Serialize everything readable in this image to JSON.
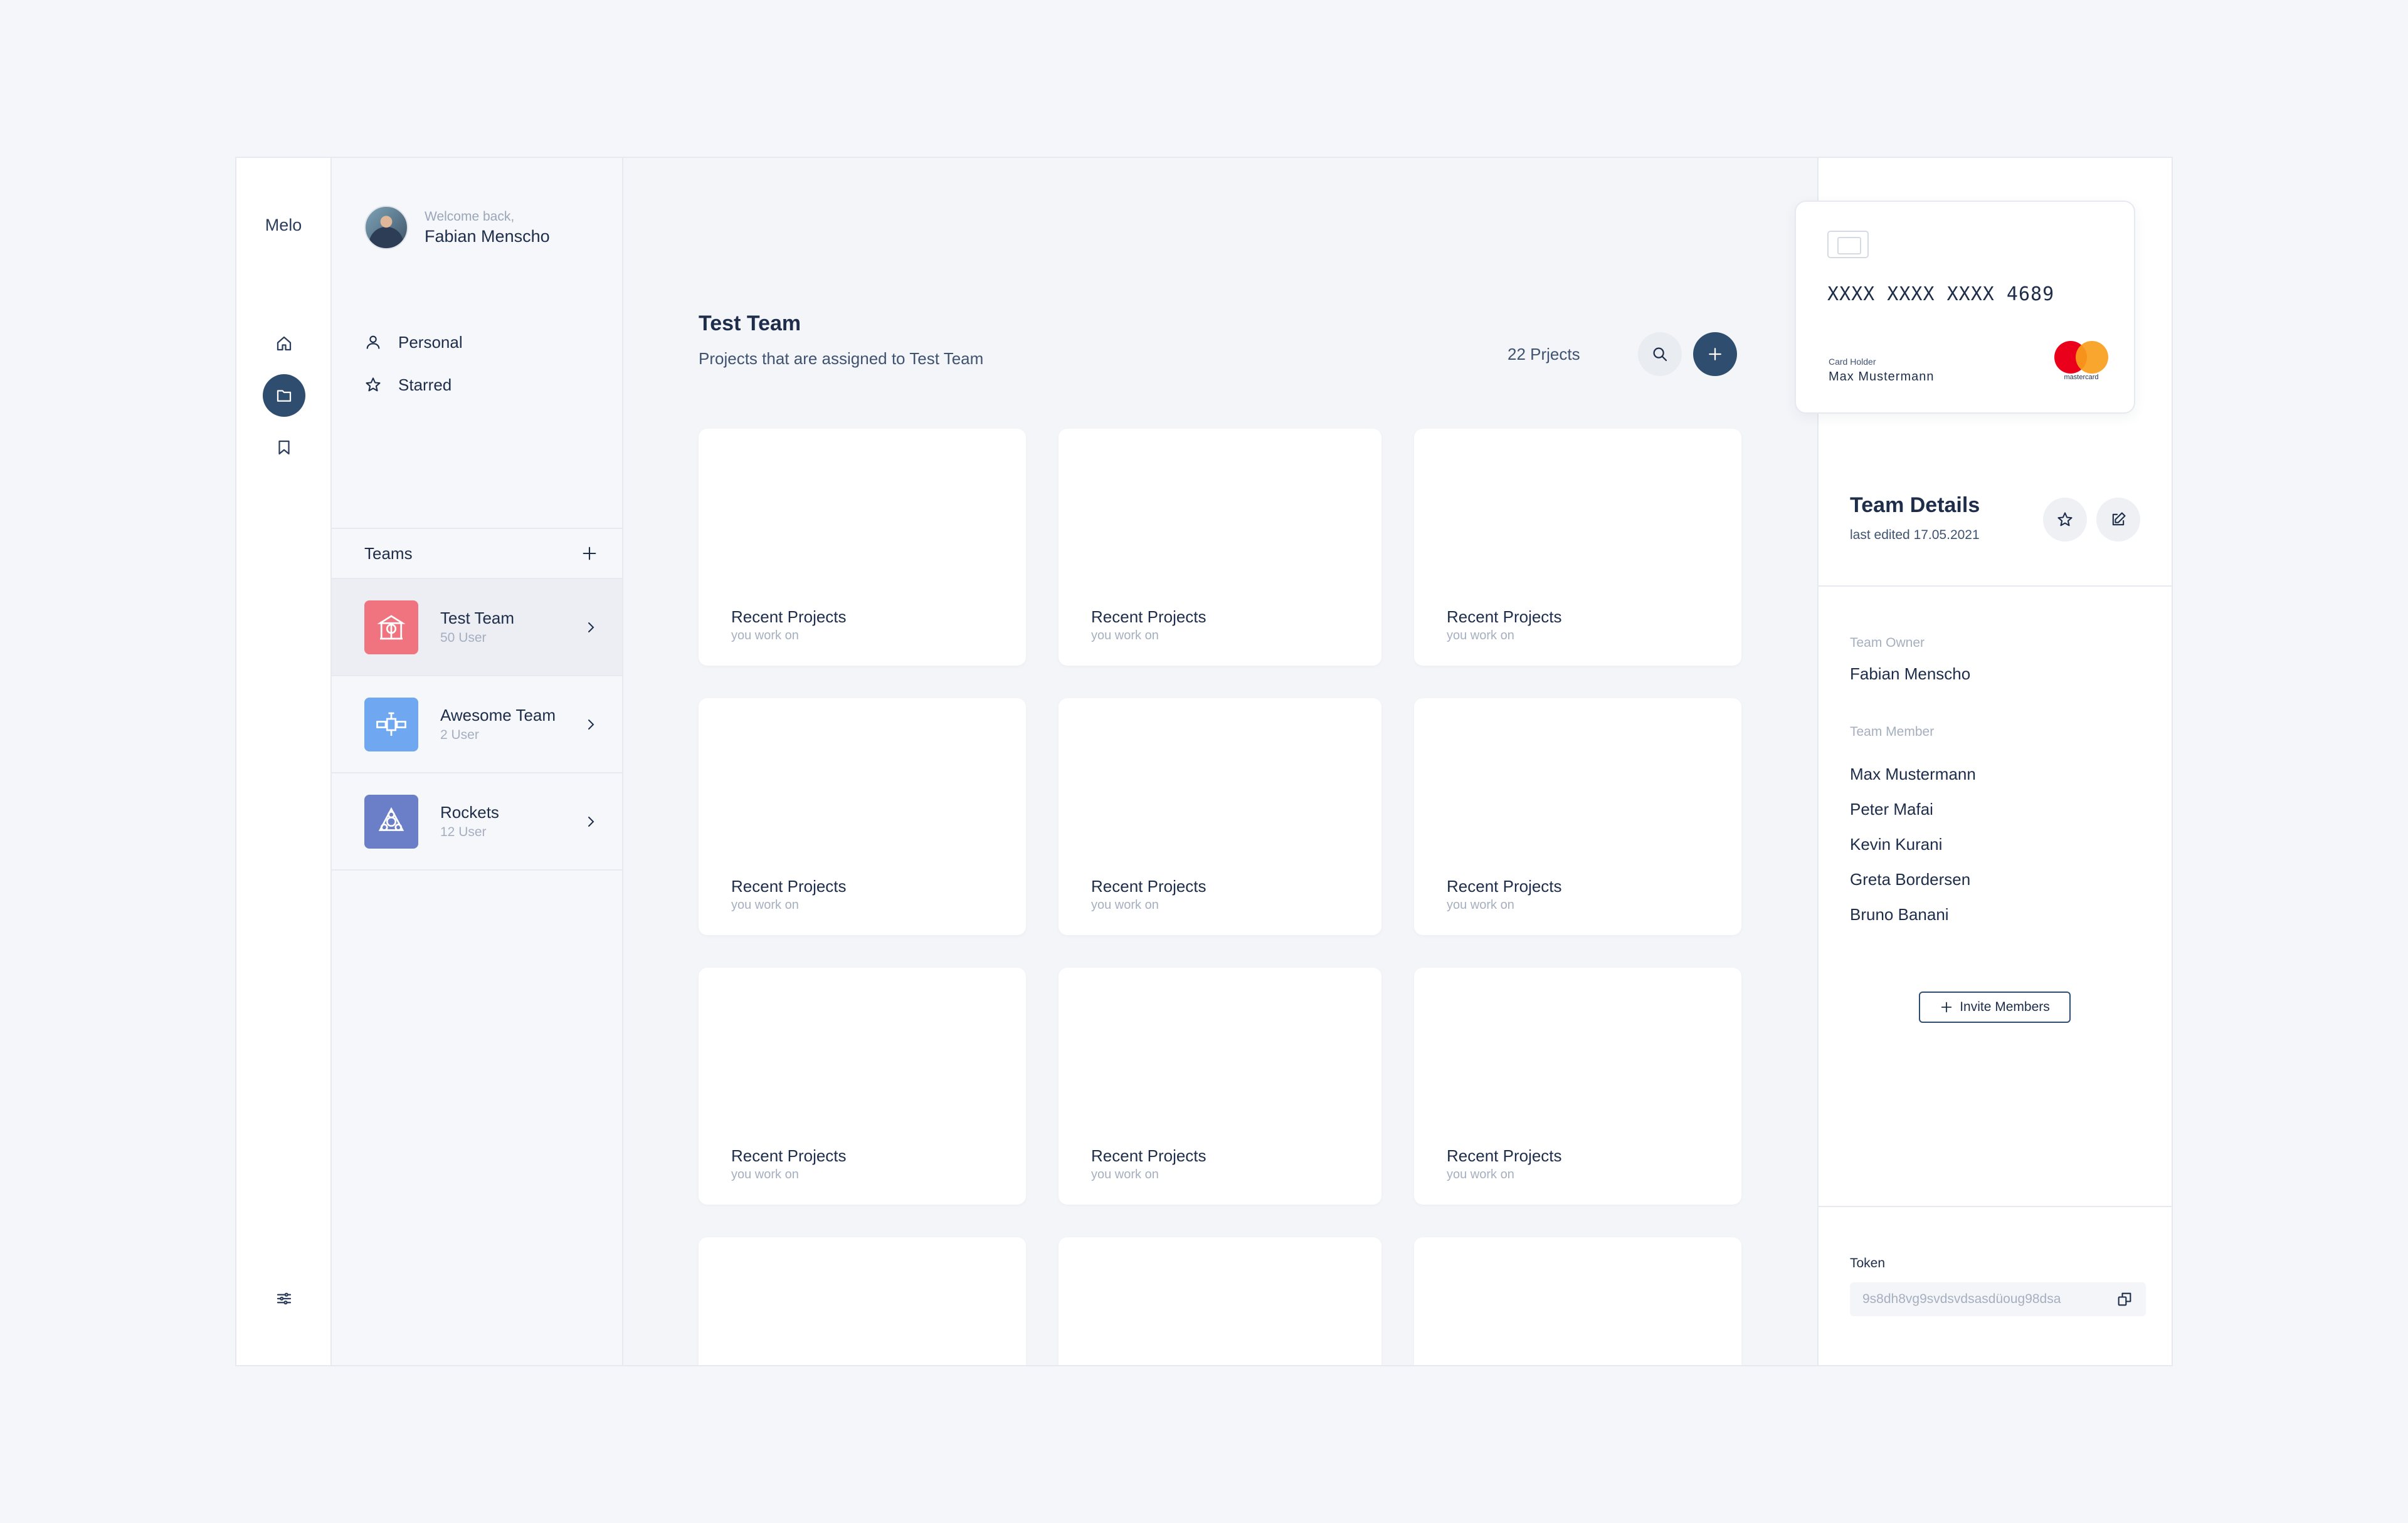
{
  "rail": {
    "brand": "Melo"
  },
  "user": {
    "welcome": "Welcome back,",
    "name": "Fabian Menscho"
  },
  "menu": [
    {
      "label": "Personal",
      "icon": "user-icon"
    },
    {
      "label": "Starred",
      "icon": "star-icon"
    }
  ],
  "teams": {
    "label": "Teams",
    "items": [
      {
        "name": "Test Team",
        "count": "50 User",
        "color": "#f07480",
        "active": true
      },
      {
        "name": "Awesome Team",
        "count": "2 User",
        "color": "#6fa8f0",
        "active": false
      },
      {
        "name": "Rockets",
        "count": "12 User",
        "color": "#6a7fc8",
        "active": false
      }
    ]
  },
  "main": {
    "title": "Test Team",
    "subtitle": "Projects that are assigned to Test Team",
    "count": "22 Prjects",
    "card": {
      "title": "Recent Projects",
      "subtitle": "you work on"
    }
  },
  "credit_card": {
    "number": "XXXX XXXX XXXX 4689",
    "holder_label": "Card Holder",
    "holder_name": "Max Mustermann",
    "brand": "mastercard"
  },
  "team_details": {
    "title": "Team Details",
    "last_edited": "last edited 17.05.2021",
    "owner_label": "Team Owner",
    "owner": "Fabian Menscho",
    "member_label": "Team Member",
    "members": [
      "Max Mustermann",
      "Peter Mafai",
      "Kevin Kurani",
      "Greta Bordersen",
      "Bruno Banani"
    ],
    "invite_label": "Invite Members",
    "token_label": "Token",
    "token": "9s8dh8vg9svdsvdsasdüoug98dsa"
  },
  "colors": {
    "accent": "#2f4d6e",
    "text": "#1d2d4a",
    "muted": "#a5afbf"
  }
}
